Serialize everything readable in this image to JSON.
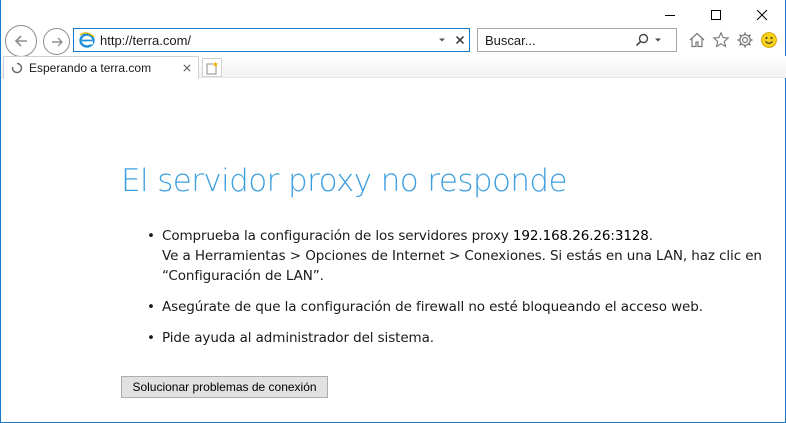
{
  "window": {
    "minimize_icon": "minimize-icon",
    "maximize_icon": "maximize-icon",
    "close_icon": "close-icon"
  },
  "navigation": {
    "back_icon": "back-arrow-icon",
    "forward_icon": "forward-arrow-icon",
    "address": {
      "url": "http://terra.com/",
      "site_icon": "ie-logo-icon",
      "dropdown_icon": "chevron-down-icon",
      "stop_icon": "close-icon"
    },
    "search": {
      "placeholder": "Buscar...",
      "search_icon": "search-icon",
      "dropdown_icon": "chevron-down-icon"
    },
    "tools": [
      {
        "icon": "home-icon"
      },
      {
        "icon": "star-icon"
      },
      {
        "icon": "gear-icon"
      },
      {
        "icon": "smiley-feedback-icon"
      }
    ]
  },
  "tabs": [
    {
      "title": "Esperando a terra.com",
      "icon": "loading-spinner-icon",
      "active": true
    }
  ],
  "new_tab_icon": "new-tab-icon",
  "page": {
    "title": "El servidor proxy no responde",
    "bullets": {
      "b1_line1_prefix": "Comprueba la configuración de los servidores proxy ",
      "b1_proxy": "192.168.26.26:3128",
      "b1_line1_suffix": ".",
      "b1_line2": "Ve a Herramientas > Opciones de Internet > Conexiones. Si estás en una LAN, haz clic en “Configuración de LAN”.",
      "b2": "Asegúrate de que la configuración de firewall no esté bloqueando el acceso web.",
      "b3": "Pide ayuda al administrador del sistema."
    },
    "fix_button": "Solucionar problemas de conexión"
  },
  "colors": {
    "accent": "#1979ca",
    "title": "#3e9fe0"
  }
}
